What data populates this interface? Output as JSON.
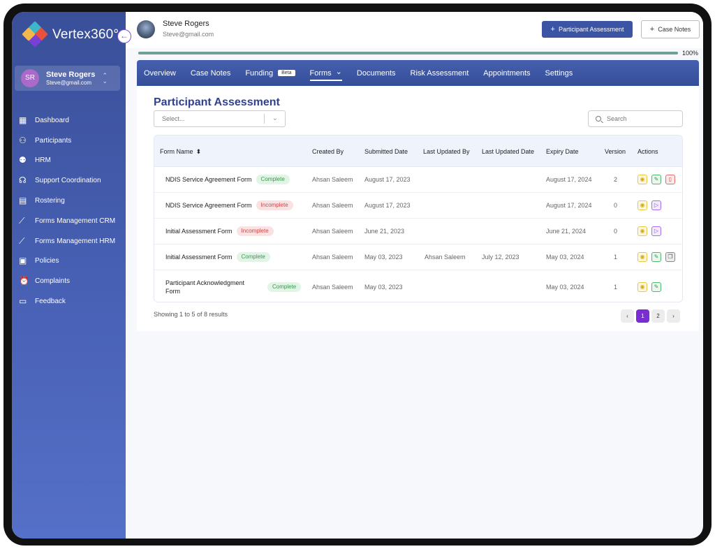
{
  "brand": {
    "name": "Vertex360°",
    "colors": [
      "#3db8c8",
      "#e8513c",
      "#7a3fd6",
      "#f2b84b"
    ]
  },
  "sidebar": {
    "user": {
      "initials": "SR",
      "name": "Steve Rogers",
      "email": "Steve@gmail.com"
    },
    "items": [
      {
        "label": "Dashboard",
        "icon": "dashboard-icon"
      },
      {
        "label": "Participants",
        "icon": "participants-icon"
      },
      {
        "label": "HRM",
        "icon": "hrm-icon"
      },
      {
        "label": "Support Coordination",
        "icon": "headset-icon"
      },
      {
        "label": "Rostering",
        "icon": "calendar-icon"
      },
      {
        "label": "Forms Management CRM",
        "icon": "chart-icon"
      },
      {
        "label": "Forms Management HRM",
        "icon": "chart-icon"
      },
      {
        "label": "Policies",
        "icon": "policies-icon"
      },
      {
        "label": "Complaints",
        "icon": "alarm-icon"
      },
      {
        "label": "Feedback",
        "icon": "feedback-icon"
      }
    ]
  },
  "header": {
    "name": "Steve Rogers",
    "email": "Steve@gmail.com",
    "primary_button": "Participant Assessment",
    "secondary_button": "Case Notes",
    "progress_percent": 100,
    "progress_label": "100%"
  },
  "tabs": [
    {
      "label": "Overview",
      "active": false
    },
    {
      "label": "Case Notes",
      "active": false
    },
    {
      "label": "Funding",
      "badge": "Beta",
      "active": false
    },
    {
      "label": "Forms",
      "dropdown": true,
      "active": true
    },
    {
      "label": "Documents",
      "active": false
    },
    {
      "label": "Risk Assessment",
      "active": false
    },
    {
      "label": "Appointments",
      "active": false
    },
    {
      "label": "Settings",
      "active": false
    }
  ],
  "page": {
    "title": "Participant Assessment",
    "select_placeholder": "Select...",
    "search_placeholder": "Search"
  },
  "table": {
    "columns": [
      "Form Name",
      "Created By",
      "Submitted Date",
      "Last Updated By",
      "Last Updated Date",
      "Expiry Date",
      "Version",
      "Actions"
    ],
    "rows": [
      {
        "form": "NDIS Service Agreement Form",
        "status": "Complete",
        "created_by": "Ahsan Saleem",
        "submitted": "August 17, 2023",
        "updated_by": "",
        "updated_date": "",
        "expiry": "August 17, 2024",
        "version": "2",
        "actions": [
          "view",
          "edit",
          "pdf"
        ]
      },
      {
        "form": "NDIS Service Agreement Form",
        "status": "Incomplete",
        "created_by": "Ahsan Saleem",
        "submitted": "August 17, 2023",
        "updated_by": "",
        "updated_date": "",
        "expiry": "August 17, 2024",
        "version": "0",
        "actions": [
          "view",
          "play"
        ]
      },
      {
        "form": "Initial Assessment Form",
        "status": "Incomplete",
        "created_by": "Ahsan Saleem",
        "submitted": "June 21, 2023",
        "updated_by": "",
        "updated_date": "",
        "expiry": "June 21, 2024",
        "version": "0",
        "actions": [
          "view",
          "play"
        ]
      },
      {
        "form": "Initial Assessment Form",
        "status": "Complete",
        "created_by": "Ahsan Saleem",
        "submitted": "May 03, 2023",
        "updated_by": "Ahsan Saleem",
        "updated_date": "July 12, 2023",
        "expiry": "May 03, 2024",
        "version": "1",
        "actions": [
          "view",
          "edit",
          "copy"
        ]
      },
      {
        "form": "Participant Acknowledgment Form",
        "status": "Complete",
        "created_by": "Ahsan Saleem",
        "submitted": "May 03, 2023",
        "updated_by": "",
        "updated_date": "",
        "expiry": "May 03, 2024",
        "version": "1",
        "actions": [
          "view",
          "edit"
        ]
      }
    ]
  },
  "footer": {
    "showing": "Showing 1 to 5 of 8 results",
    "pages": [
      "1",
      "2"
    ],
    "current_page": "1"
  }
}
